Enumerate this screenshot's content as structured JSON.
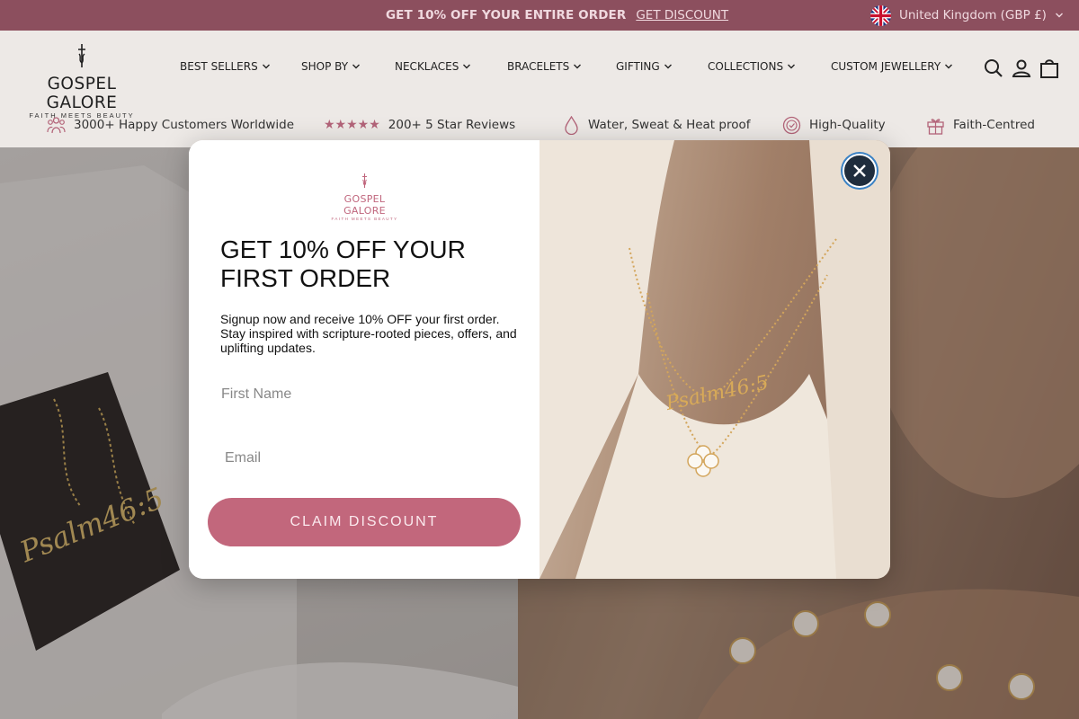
{
  "announcement": {
    "text": "GET 10% OFF YOUR ENTIRE ORDER",
    "link": "GET DISCOUNT",
    "country": "United Kingdom (GBP £)"
  },
  "header": {
    "logo": {
      "name": "GOSPEL GALORE",
      "tagline": "FAITH MEETS BEAUTY"
    },
    "nav": [
      {
        "label": "BEST SELLERS"
      },
      {
        "label": "SHOP BY"
      },
      {
        "label": "NECKLACES"
      },
      {
        "label": "BRACELETS"
      },
      {
        "label": "GIFTING"
      },
      {
        "label": "COLLECTIONS"
      },
      {
        "label": "CUSTOM JEWELLERY"
      }
    ],
    "icons": [
      "search-icon",
      "account-icon",
      "cart-icon"
    ]
  },
  "usps": [
    {
      "icon": "people-icon",
      "label": "3000+ Happy Customers Worldwide"
    },
    {
      "icon": "stars-icon",
      "label": "200+ 5 Star Reviews",
      "rating": 5
    },
    {
      "icon": "droplet-icon",
      "label": "Water, Sweat & Heat proof"
    },
    {
      "icon": "quality-badge-icon",
      "label": "High-Quality"
    },
    {
      "icon": "gift-icon",
      "label": "Faith-Centred"
    }
  ],
  "modal": {
    "logo": {
      "name": "GOSPEL GALORE",
      "tagline": "FAITH MEETS BEAUTY"
    },
    "title": "GET 10% OFF YOUR FIRST ORDER",
    "description": "Signup now and receive 10% OFF your first order. Stay inspired with scripture-rooted pieces, offers, and uplifting updates.",
    "first_name_placeholder": "First Name",
    "email_placeholder": "Email",
    "claim_label": "CLAIM DISCOUNT",
    "image_text": "Psalm46:5"
  },
  "hero": {
    "left_image_text": "Psalm46:5"
  },
  "colors": {
    "announcement_bg": "#8c4f5e",
    "accent": "#c2677c",
    "header_bg": "#ede9e6"
  }
}
